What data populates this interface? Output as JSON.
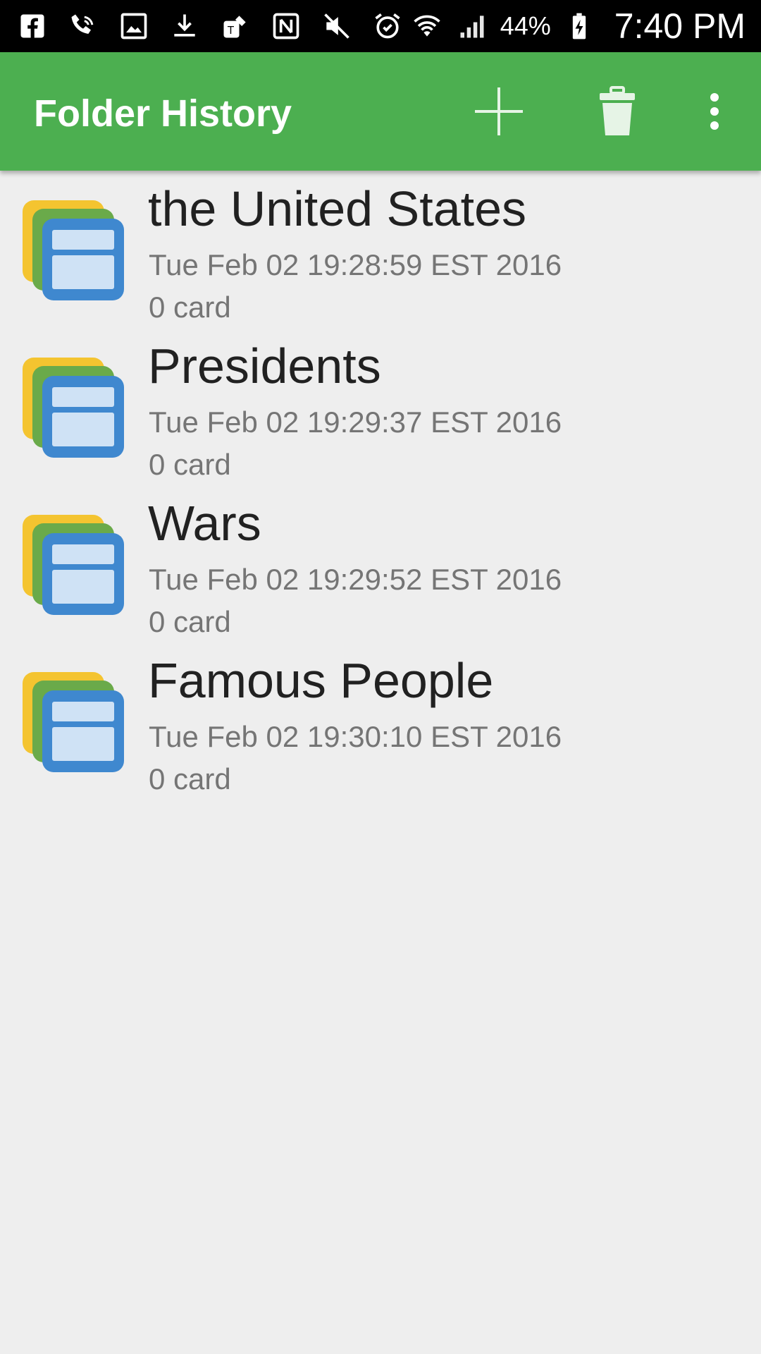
{
  "status_bar": {
    "battery_percent": "44%",
    "time": "7:40 PM",
    "icons_left": [
      "facebook-icon",
      "wifi-call-icon",
      "image-icon",
      "download-icon",
      "tmobile-icon",
      "nfc-icon",
      "mute-icon",
      "alarm-icon"
    ],
    "icons_right": [
      "wifi-icon",
      "signal-icon",
      "battery-charging-icon"
    ]
  },
  "app_bar": {
    "title": "Folder History",
    "actions": [
      "add-icon",
      "delete-icon",
      "overflow-menu-icon"
    ],
    "color": "#4caf50"
  },
  "folders": [
    {
      "name": "the United States",
      "date": "Tue Feb 02 19:28:59 EST 2016",
      "count": "0 card"
    },
    {
      "name": "Presidents",
      "date": "Tue Feb 02 19:29:37 EST 2016",
      "count": "0 card"
    },
    {
      "name": "Wars",
      "date": "Tue Feb 02 19:29:52 EST 2016",
      "count": "0 card"
    },
    {
      "name": "Famous People",
      "date": "Tue Feb 02 19:30:10 EST 2016",
      "count": "0 card"
    }
  ],
  "colors": {
    "icon_back": "#f4c430",
    "icon_middle": "#6aaa4a",
    "icon_front": "#3f88cf",
    "icon_front_fill": "#cfe2f5"
  }
}
